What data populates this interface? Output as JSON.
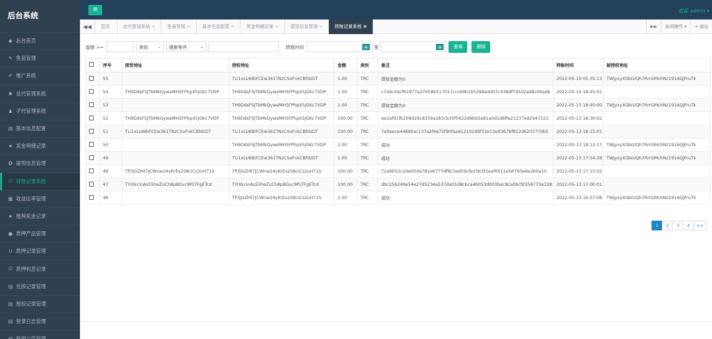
{
  "app_title": "后台系统",
  "sidebar": {
    "items": [
      {
        "label": "后台首页",
        "icon": "◆",
        "active": false
      },
      {
        "label": "鱼苗管理",
        "icon": "✎",
        "active": false
      },
      {
        "label": "推广系统",
        "icon": "✐",
        "active": false
      },
      {
        "label": "总代管理系统",
        "icon": "✱",
        "active": false
      },
      {
        "label": "子代管理系统",
        "icon": "♟",
        "active": false
      },
      {
        "label": "基本信息配置",
        "icon": "▤",
        "active": false
      },
      {
        "label": "奖金明细记录",
        "icon": "★",
        "active": false
      },
      {
        "label": "提现信息管理",
        "icon": "✪",
        "active": false
      },
      {
        "label": "转账记录系统",
        "icon": "⏻",
        "active": true
      },
      {
        "label": "收益比率管理",
        "icon": "▦",
        "active": false
      },
      {
        "label": "推荐奖金记录",
        "icon": "★",
        "active": false
      },
      {
        "label": "质押产品管理",
        "icon": "●",
        "active": false
      },
      {
        "label": "质押记录管理",
        "icon": "U",
        "active": false
      },
      {
        "label": "质押利息记录",
        "icon": "⏻",
        "active": false
      },
      {
        "label": "兑换记录管理",
        "icon": "▤",
        "active": false
      },
      {
        "label": "授权记录管理",
        "icon": "▤",
        "active": false
      },
      {
        "label": "登录日志管理",
        "icon": "▤",
        "active": false
      },
      {
        "label": "新闻公告管理",
        "icon": "▤",
        "active": false
      }
    ]
  },
  "header": {
    "welcome": "欢迎 admin ▾",
    "menu_button": "≡"
  },
  "tabs": {
    "prev": "◀◀",
    "next": "▶▶",
    "close_ops": "关闭操作 ▾",
    "exit": "⇥ 退出",
    "items": [
      {
        "label": "首页",
        "close": "",
        "active": false
      },
      {
        "label": "总代管理系统",
        "close": "⊗",
        "active": false
      },
      {
        "label": "鱼苗管理",
        "close": "⊗",
        "active": false
      },
      {
        "label": "基本信息配置",
        "close": "⊗",
        "active": false
      },
      {
        "label": "奖金明细记录",
        "close": "⊗",
        "active": false
      },
      {
        "label": "提现信息管理",
        "close": "⊗",
        "active": false
      },
      {
        "label": "转账记录系统",
        "close": "⊗",
        "active": true
      }
    ]
  },
  "filter": {
    "amount_label": "金额 >=",
    "amount_value": "",
    "category_select": "类别",
    "search_select": "搜索条件",
    "search_value": "",
    "time_label": "转账时间",
    "to_label": "至",
    "cal_icon": "cal",
    "query_button": "查询",
    "delete_button": "删除"
  },
  "table": {
    "columns": [
      "",
      "序号",
      "接受地址",
      "授权地址",
      "金额",
      "类别",
      "备注",
      "转账时间",
      "被授权地址"
    ],
    "rows": [
      {
        "id": "55",
        "recv": "",
        "auth": "TLi1xLU6BiFCEw361TNzCSoFnkCBfdzDT",
        "amount": "1.00",
        "type": "TRC",
        "note": "提现金额为0",
        "time": "2022-05-19 05:35:13",
        "authorized": "TWJyxyXGbiUQh7RrrGMchNz191AQJFruTk"
      },
      {
        "id": "54",
        "recv": "TH9DdsFSJTbMkQyweMH5FPhpX5jGKc7VDP",
        "auth": "TH9DdsFSJTbMkQyweMH5FPhpX5jGKc7VDP",
        "amount": "1.00",
        "type": "TRC",
        "note": "c7a9c44cf61977a27658b517017ccc69b1b5399edd07c438df79502ad8c06adb",
        "time": "2022-05-14 18:45:01",
        "authorized": ""
      },
      {
        "id": "53",
        "recv": "",
        "auth": "TH9DdsFSJTbMkQyweMH5FPhpX5jGKc7VDP",
        "amount": "1.00",
        "type": "TRC",
        "note": "提现金额为0",
        "time": "2022-05-13 18:40:00",
        "authorized": "TWJyxyXGbiUQh7RrrGMchNz191AQJFruTk"
      },
      {
        "id": "52",
        "recv": "TH9DdsFSJTbMkQyweMH5FPhpX5jGKc7VDP",
        "auth": "TH9DdsFSJTbMkQyweMH5FPhpX5jGKc7VDP",
        "amount": "100.00",
        "type": "TRC",
        "note": "ee2af91fb206d29cd359a183cb30f5622d9bd3a91a0d1d6ffa21237ed2947223",
        "time": "2022-05-13 18:30:02",
        "authorized": ""
      },
      {
        "id": "51",
        "recv": "TLi1xLU6BiFCEw361TNzCSoFnkCBfdzDT",
        "auth": "TLi1xLU6BiFCEw361TNzCSoFnkCBfdzDT",
        "amount": "100.00",
        "type": "TRC",
        "note": "7e9aece44890ac137a2f4e75f90faa412102d9f32e13e9367bf812d6203770b5",
        "time": "2022-05-13 18:15:01",
        "authorized": ""
      },
      {
        "id": "50",
        "recv": "",
        "auth": "TH9DdsFSJTbMkQyweMH5FPhpX5jGKc7VDP",
        "amount": "1.00",
        "type": "TRC",
        "note": "成功",
        "time": "2022-05-13 18:12:17",
        "authorized": "TWJyxyXGbiUQh7RrrGMchNz191AQJFruTk"
      },
      {
        "id": "49",
        "recv": "",
        "auth": "TLi1xLU6BiFCEw361TNzCSoFnkCBfdzDT",
        "amount": "1.00",
        "type": "TRC",
        "note": "成功",
        "time": "2022-05-13 17:54:28",
        "authorized": "TWJyxyXGbiUQh7RrrGMchNz191AQJFruTk"
      },
      {
        "id": "48",
        "recv": "TP3jGZHt7JCWnw24yKrEs2S8ciCz2uH71S",
        "auth": "TP3jGZHt7JCWnw24yKrEs2S8ciCz2uH71S",
        "amount": "100.00",
        "type": "TRC",
        "note": "72a9052c2de05da781e6777df8c5ed59cfe2563f2aaf0011efaf793e6e2b0a10",
        "time": "2022-05-13 17:15:02",
        "authorized": ""
      },
      {
        "id": "47",
        "recv": "TYiXkcinAs55heZuCh8pBGvc9PLTFgETcd",
        "auth": "TYiXkcinAs55heZuCh8pBGvc9PLTFgETcd",
        "amount": "100.00",
        "type": "TRC",
        "note": "dbc256249e54e27d5234a537da01d8cbca4b053d003bac8ca0bcfd358773e328",
        "time": "2022-05-13 17:00:01",
        "authorized": ""
      },
      {
        "id": "46",
        "recv": "",
        "auth": "TP3jGZHt7JCWnw24yKrEs2S8ciCz2uH71S",
        "amount": "1.00",
        "type": "TRC",
        "note": "成功",
        "time": "2022-05-13 16:57:08",
        "authorized": "TWJyxyXGbiUQh7RrrGMchNz191AQJFruTk"
      }
    ]
  },
  "pagination": [
    "1",
    "2",
    "3",
    "4",
    ">>"
  ],
  "colors": {
    "sidebar_bg": "#2f4050",
    "accent": "#1ab394",
    "active_text": "#19aa8d",
    "pager_active": "#1c84c6"
  }
}
